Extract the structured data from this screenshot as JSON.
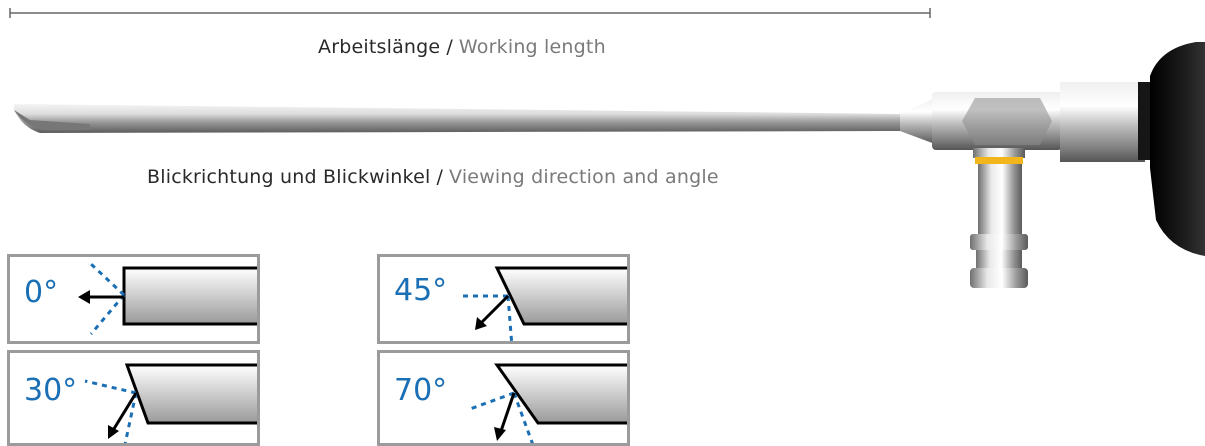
{
  "captions": {
    "working_length_de": "Arbeitslänge",
    "working_length_sep": "/",
    "working_length_en": "Working length",
    "viewing_de": "Blickrichtung und Blickwinkel",
    "viewing_sep": "/",
    "viewing_en": "Viewing direction and angle"
  },
  "angles": [
    {
      "label": "0°"
    },
    {
      "label": "30°"
    },
    {
      "label": "45°"
    },
    {
      "label": "70°"
    }
  ],
  "colors": {
    "accent_blue": "#1a6fb5",
    "panel_border": "#9b9b9b",
    "dimension_line": "#666666",
    "eyepiece_black": "#111111",
    "ring_yellow": "#f2b51c"
  },
  "icons": {
    "scope": "endoscope-illustration",
    "arrow": "viewing-direction-arrow"
  }
}
